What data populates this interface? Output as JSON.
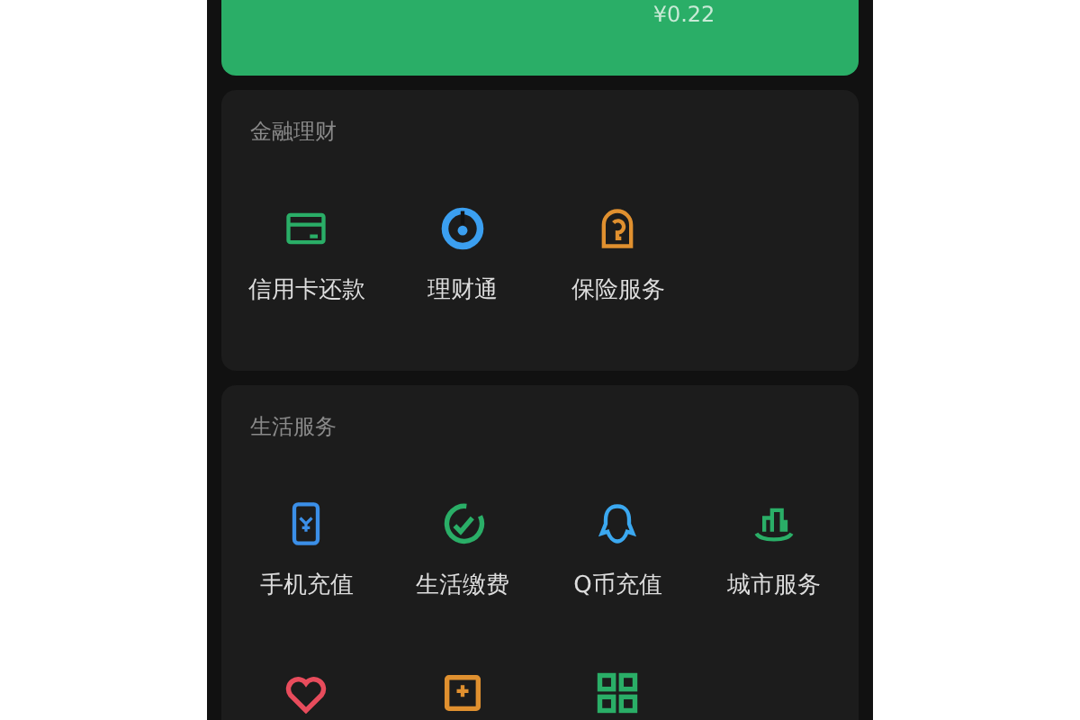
{
  "balance_card": {
    "amount": "¥0.22"
  },
  "sections": [
    {
      "title": "金融理财",
      "items": [
        {
          "kind": "card",
          "label": "信用卡还款"
        },
        {
          "kind": "wealth",
          "label": "理财通"
        },
        {
          "kind": "insurance",
          "label": "保险服务"
        }
      ]
    },
    {
      "title": "生活服务",
      "items": [
        {
          "kind": "phone",
          "label": "手机充值"
        },
        {
          "kind": "utility",
          "label": "生活缴费"
        },
        {
          "kind": "penguin",
          "label": "Q币充值"
        },
        {
          "kind": "city",
          "label": "城市服务"
        },
        {
          "kind": "heart"
        },
        {
          "kind": "box"
        },
        {
          "kind": "grid"
        }
      ]
    }
  ]
}
